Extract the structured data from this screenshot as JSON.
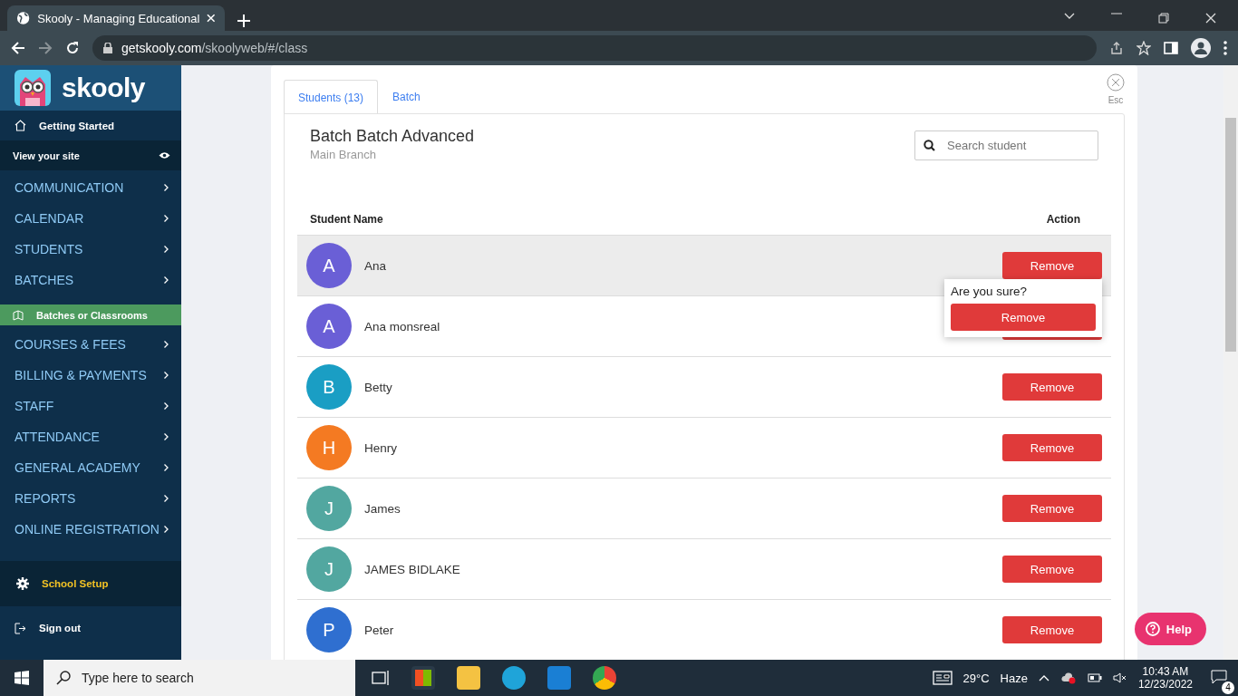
{
  "browser": {
    "tab_title": "Skooly - Managing Educational",
    "url_host": "getskooly.com",
    "url_path": "/skoolyweb/#/class"
  },
  "sidebar": {
    "logo_text": "skooly",
    "getting_started": "Getting Started",
    "view_site": "View your site",
    "items": [
      {
        "label": "COMMUNICATION",
        "kind": "section",
        "selected": false
      },
      {
        "label": "CALENDAR",
        "kind": "section",
        "selected": false
      },
      {
        "label": "STUDENTS",
        "kind": "section",
        "selected": false
      },
      {
        "label": "BATCHES",
        "kind": "section",
        "selected": false
      },
      {
        "label": "Batches or Classrooms",
        "kind": "subitem",
        "selected": true
      },
      {
        "label": "COURSES & FEES",
        "kind": "section",
        "selected": false
      },
      {
        "label": "BILLING & PAYMENTS",
        "kind": "section",
        "selected": false
      },
      {
        "label": "STAFF",
        "kind": "section",
        "selected": false
      },
      {
        "label": "ATTENDANCE",
        "kind": "section",
        "selected": false
      },
      {
        "label": "GENERAL ACADEMY",
        "kind": "section",
        "selected": false
      },
      {
        "label": "REPORTS",
        "kind": "section",
        "selected": false
      },
      {
        "label": "ONLINE REGISTRATION",
        "kind": "section",
        "selected": false
      }
    ],
    "school_setup": "School Setup",
    "sign_out": "Sign out"
  },
  "panel": {
    "tabs": [
      {
        "label": "Students (13)",
        "selected": true
      },
      {
        "label": "Batch",
        "selected": false
      }
    ],
    "esc": "Esc",
    "title": "Batch Batch Advanced",
    "subtitle": "Main Branch",
    "search": {
      "placeholder": "Search student"
    },
    "columns": [
      "Student Name",
      "Action"
    ],
    "rows": [
      {
        "initial": "A",
        "name": "Ana",
        "color": "#6a5fd6",
        "highlighted": true,
        "action": "Remove"
      },
      {
        "initial": "A",
        "name": "Ana monsreal",
        "color": "#6a5fd6",
        "highlighted": false
      },
      {
        "initial": "B",
        "name": "Betty",
        "color": "#1a9ec4",
        "highlighted": false,
        "action": "Remove"
      },
      {
        "initial": "H",
        "name": "Henry",
        "color": "#f47a22",
        "highlighted": false,
        "action": "Remove"
      },
      {
        "initial": "J",
        "name": "James",
        "color": "#52a7a0",
        "highlighted": false,
        "action": "Remove"
      },
      {
        "initial": "J",
        "name": "JAMES BIDLAKE",
        "color": "#52a7a0",
        "highlighted": false,
        "action": "Remove"
      },
      {
        "initial": "P",
        "name": "Peter",
        "color": "#2f6fd0",
        "highlighted": false,
        "action": "Remove"
      }
    ],
    "confirm": {
      "question": "Are you sure?",
      "button": "Remove"
    },
    "help": "Help"
  },
  "taskbar": {
    "search_placeholder": "Type here to search",
    "temperature": "29°C",
    "weather": "Haze",
    "time": "10:43 AM",
    "date": "12/23/2022",
    "notifications": "4"
  }
}
